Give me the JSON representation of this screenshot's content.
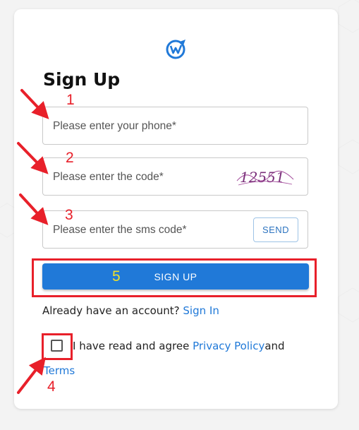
{
  "page": {
    "title": "Sign Up"
  },
  "form": {
    "phone_placeholder": "Please enter your phone*",
    "code_placeholder": "Please enter the code*",
    "captcha_text": "12551",
    "sms_placeholder": "Please enter the sms code*",
    "send_label": "SEND",
    "signup_label": "SIGN UP"
  },
  "footer": {
    "already_text": "Already have an account?",
    "signin_link": "Sign In",
    "agree_text": "I have read and agree",
    "privacy_link": "Privacy Policy",
    "and_text": "and",
    "terms_link": "Terms"
  },
  "annotations": {
    "n1": "1",
    "n2": "2",
    "n3": "3",
    "n4": "4",
    "n5": "5"
  },
  "icons": {
    "logo": "brand-logo-icon"
  },
  "colors": {
    "primary": "#2079d8",
    "annotation_red": "#e8202a",
    "annotation_yellow": "#f0e02a"
  }
}
